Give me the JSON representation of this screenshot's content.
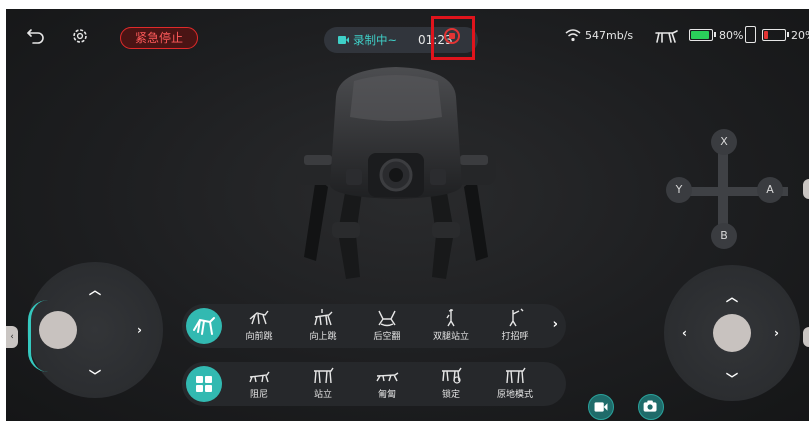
{
  "topbar": {
    "back_icon": "back-arrow-icon",
    "settings_icon": "gear-icon",
    "emergency_stop_label": "紧急停止",
    "recording": {
      "label": "录制中~",
      "time": "01:23",
      "camera_icon": "video-camera-icon",
      "stop_icon": "stop-circle-icon"
    },
    "status": {
      "network_speed": "547mb/s",
      "robot_battery_pct": 80,
      "robot_battery_label": "80%",
      "phone_battery_pct": 20,
      "phone_battery_label": "20%"
    }
  },
  "dpad": {
    "top": "X",
    "left": "Y",
    "right": "A",
    "bottom": "B"
  },
  "actions_row_1": {
    "lead_icon": "dog-tricks-icon",
    "items": [
      {
        "label": "向前跳",
        "icon": "jump-forward-icon"
      },
      {
        "label": "向上跳",
        "icon": "jump-up-icon"
      },
      {
        "label": "后空翻",
        "icon": "backflip-icon"
      },
      {
        "label": "双腿站立",
        "icon": "stand-two-legs-icon"
      },
      {
        "label": "打招呼",
        "icon": "wave-hello-icon"
      }
    ]
  },
  "actions_row_2": {
    "lead_icon": "grid-menu-icon",
    "items": [
      {
        "label": "阻尼",
        "icon": "damping-icon"
      },
      {
        "label": "站立",
        "icon": "stand-icon"
      },
      {
        "label": "匍匐",
        "icon": "crawl-icon"
      },
      {
        "label": "锁定",
        "icon": "lock-pose-icon"
      },
      {
        "label": "原地模式",
        "icon": "in-place-mode-icon"
      }
    ]
  },
  "colors": {
    "accent": "#32b9b1",
    "danger": "#e23434",
    "highlight_box": "#e0141c",
    "background": "#1d1e20"
  }
}
